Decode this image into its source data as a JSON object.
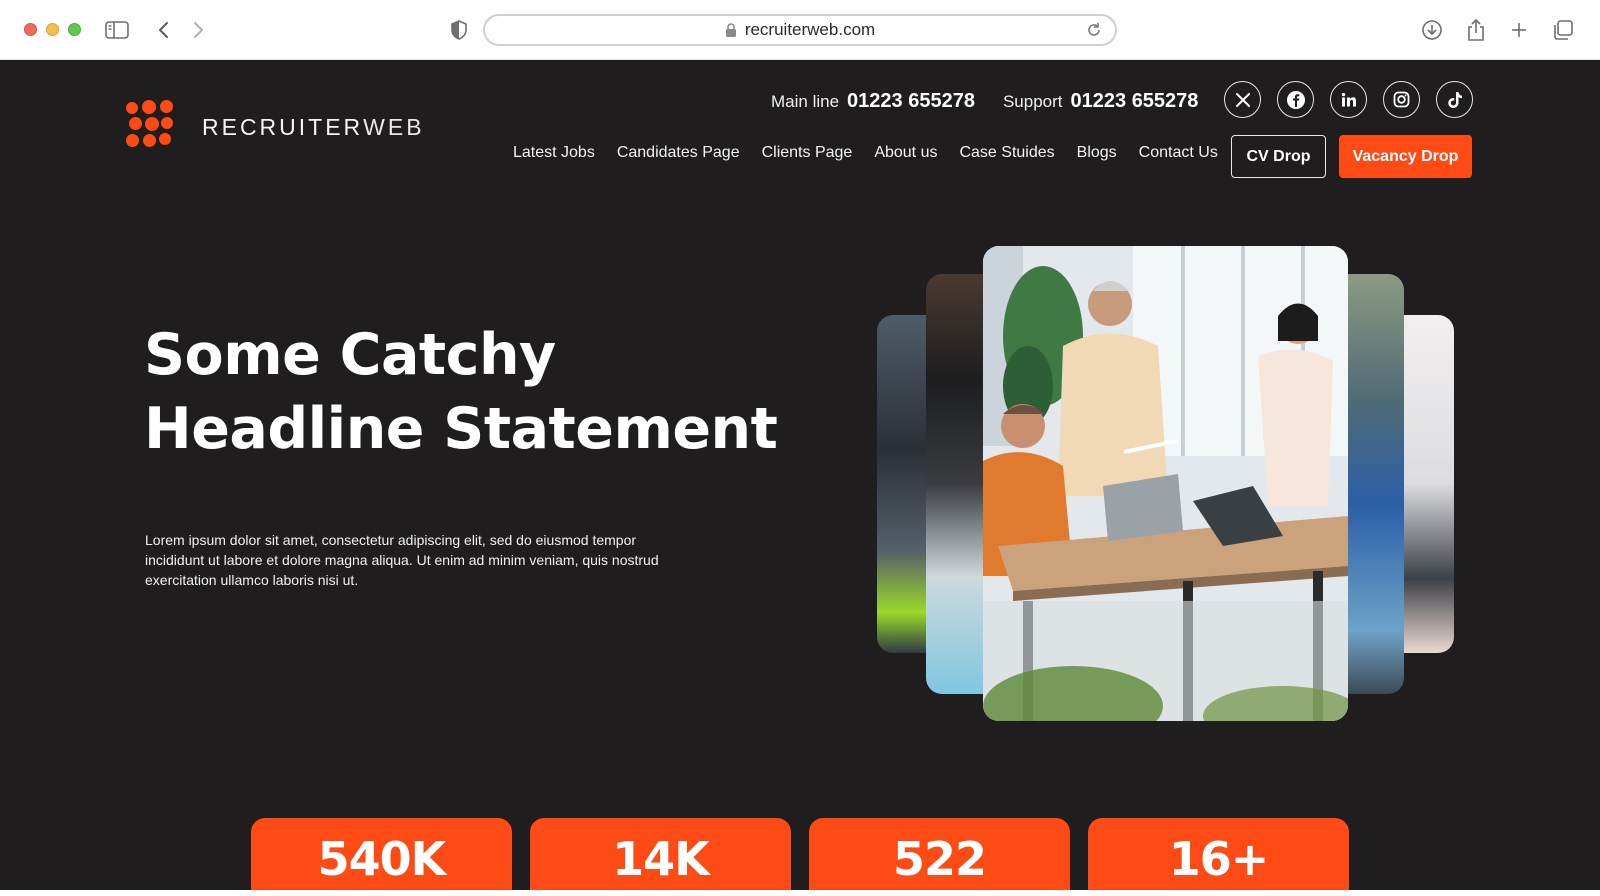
{
  "browser": {
    "url": "recruiterweb.com"
  },
  "brand": {
    "name_bold": "RECRUITER",
    "name_light": "WEB",
    "accent_color": "#fe4a14"
  },
  "contact": {
    "main_label": "Main line",
    "main_number": "01223 655278",
    "support_label": "Support",
    "support_number": "01223 655278"
  },
  "socials": [
    {
      "icon": "x-icon",
      "glyph": "𝕏"
    },
    {
      "icon": "facebook-icon",
      "glyph": "f"
    },
    {
      "icon": "linkedin-icon",
      "glyph": "in"
    },
    {
      "icon": "instagram-icon",
      "glyph": "◎"
    },
    {
      "icon": "tiktok-icon",
      "glyph": "♪"
    }
  ],
  "nav": {
    "items": [
      "Latest Jobs",
      "Candidates Page",
      "Clients Page",
      "About us",
      "Case Stuides",
      "Blogs",
      "Contact Us"
    ],
    "cv_drop": "CV Drop",
    "vacancy_drop": "Vacancy Drop"
  },
  "hero": {
    "headline_line1": "Some Catchy",
    "headline_line2": "Headline Statement",
    "lead": "Lorem ipsum dolor sit amet, consectetur adipiscing elit, sed do eiusmod tempor incididunt ut labore et dolore magna aliqua. Ut enim ad minim veniam, quis nostrud exercitation ullamco laboris nisi ut."
  },
  "stats": [
    "540K",
    "14K",
    "522",
    "16+"
  ]
}
